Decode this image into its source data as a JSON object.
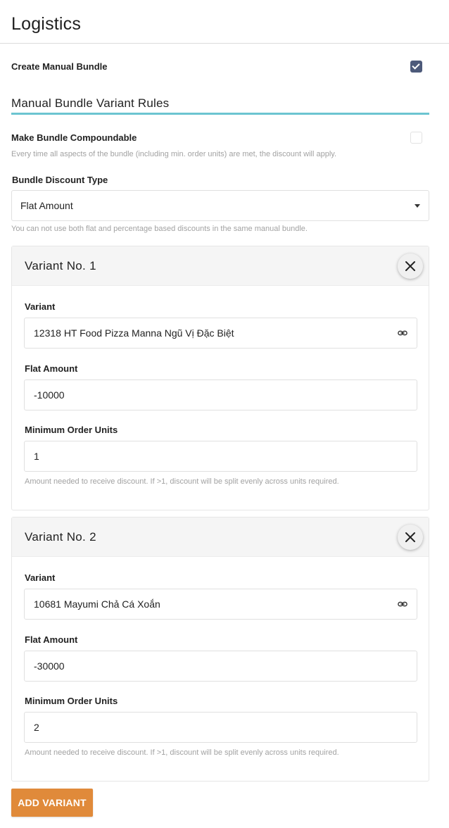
{
  "page": {
    "title": "Logistics"
  },
  "create_manual_bundle": {
    "label": "Create Manual Bundle",
    "checked": true
  },
  "section": {
    "title": "Manual Bundle Variant Rules"
  },
  "compoundable": {
    "label": "Make Bundle Compoundable",
    "checked": false,
    "help": "Every time all aspects of the bundle (including min. order units) are met, the discount will apply."
  },
  "discount_type": {
    "label": "Bundle Discount Type",
    "value": "Flat Amount",
    "help": "You can not use both flat and percentage based discounts in the same manual bundle."
  },
  "variants": [
    {
      "title": "Variant No. 1",
      "variant_label": "Variant",
      "variant_value": "12318 HT Food Pizza Manna Ngũ Vị Đặc Biệt",
      "amount_label": "Flat Amount",
      "amount_value": "-10000",
      "min_units_label": "Minimum Order Units",
      "min_units_value": "1",
      "help": "Amount needed to receive discount. If >1, discount will be split evenly across units required."
    },
    {
      "title": "Variant No. 2",
      "variant_label": "Variant",
      "variant_value": "10681 Mayumi Chả Cá Xoắn",
      "amount_label": "Flat Amount",
      "amount_value": "-30000",
      "min_units_label": "Minimum Order Units",
      "min_units_value": "2",
      "help": "Amount needed to receive discount. If >1, discount will be split evenly across units required."
    }
  ],
  "add_variant_label": "ADD VARIANT",
  "colors": {
    "accent": "#6cc5d1",
    "button": "#e08a3a",
    "checkbox": "#4d5a7a"
  },
  "icons": {
    "close": "close-icon",
    "link": "link-icon",
    "dropdown": "caret-down-icon"
  }
}
